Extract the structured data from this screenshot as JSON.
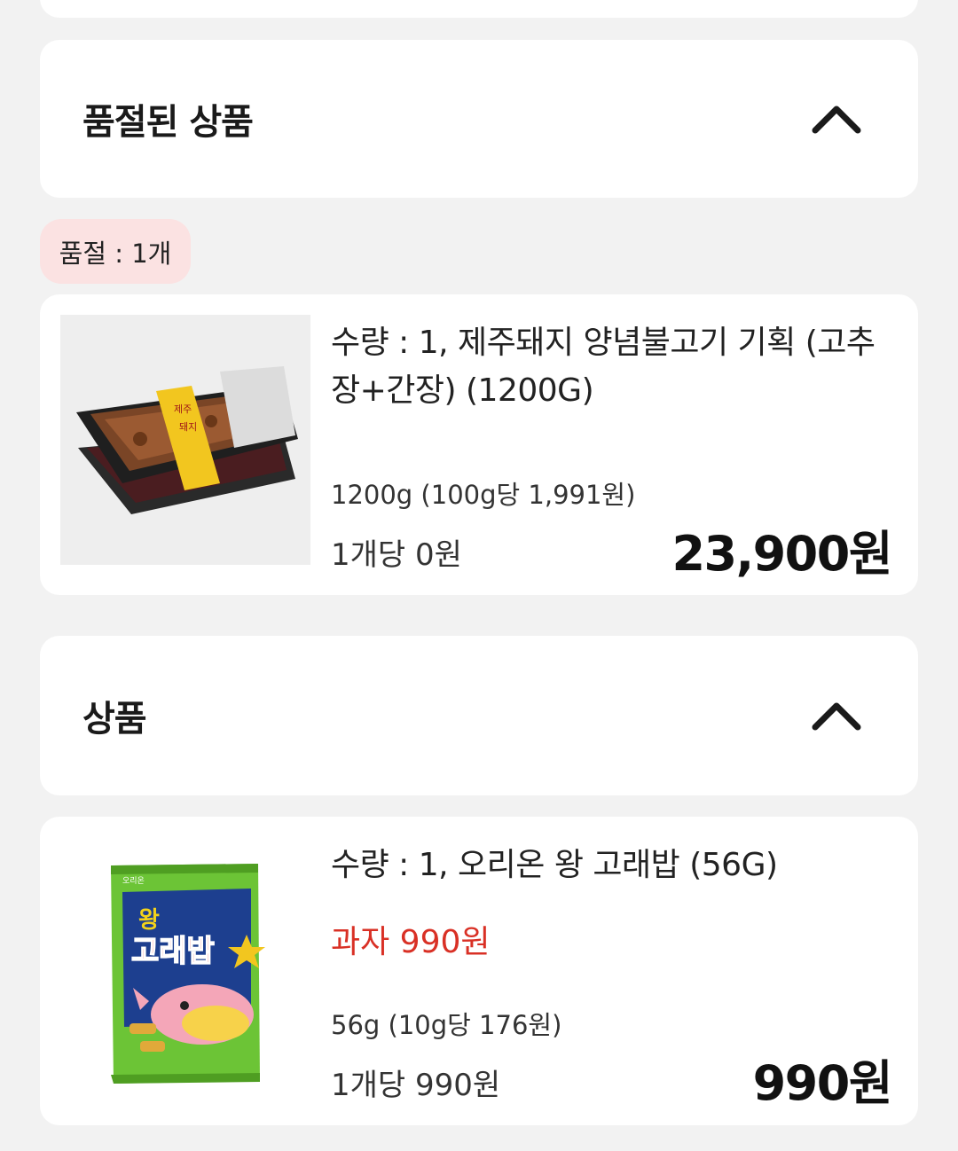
{
  "soldout_section": {
    "title": "품절된 상품",
    "toggle_icon": "chevron-up-icon"
  },
  "soldout_badge": {
    "label": "품절 : 1개"
  },
  "soldout_item": {
    "name": "수량 : 1, 제주돼지 양념불고기 기획 (고추장+간장) (1200G)",
    "unit_price": "1200g (100g당 1,991원)",
    "per_item": "1개당 0원",
    "price": "23,900원",
    "image_icon": "pork-bulgogi-tray-image",
    "sticker_line1": "제주",
    "sticker_line2": "돼지"
  },
  "products_section": {
    "title": "상품",
    "toggle_icon": "chevron-up-icon"
  },
  "product_item": {
    "name": "수량 : 1, 오리온 왕 고래밥 (56G)",
    "promo": "과자 990원",
    "unit_price": "56g (10g당 176원)",
    "per_item": "1개당 990원",
    "price": "990원",
    "image_icon": "snack-bag-image",
    "bag_brand": "오리온",
    "bag_title_top": "왕",
    "bag_title": "고래밥"
  },
  "colors": {
    "promo_red": "#d93025",
    "badge_bg": "#fbe2e2",
    "page_bg": "#f2f2f2",
    "snack_green": "#6cc436"
  }
}
